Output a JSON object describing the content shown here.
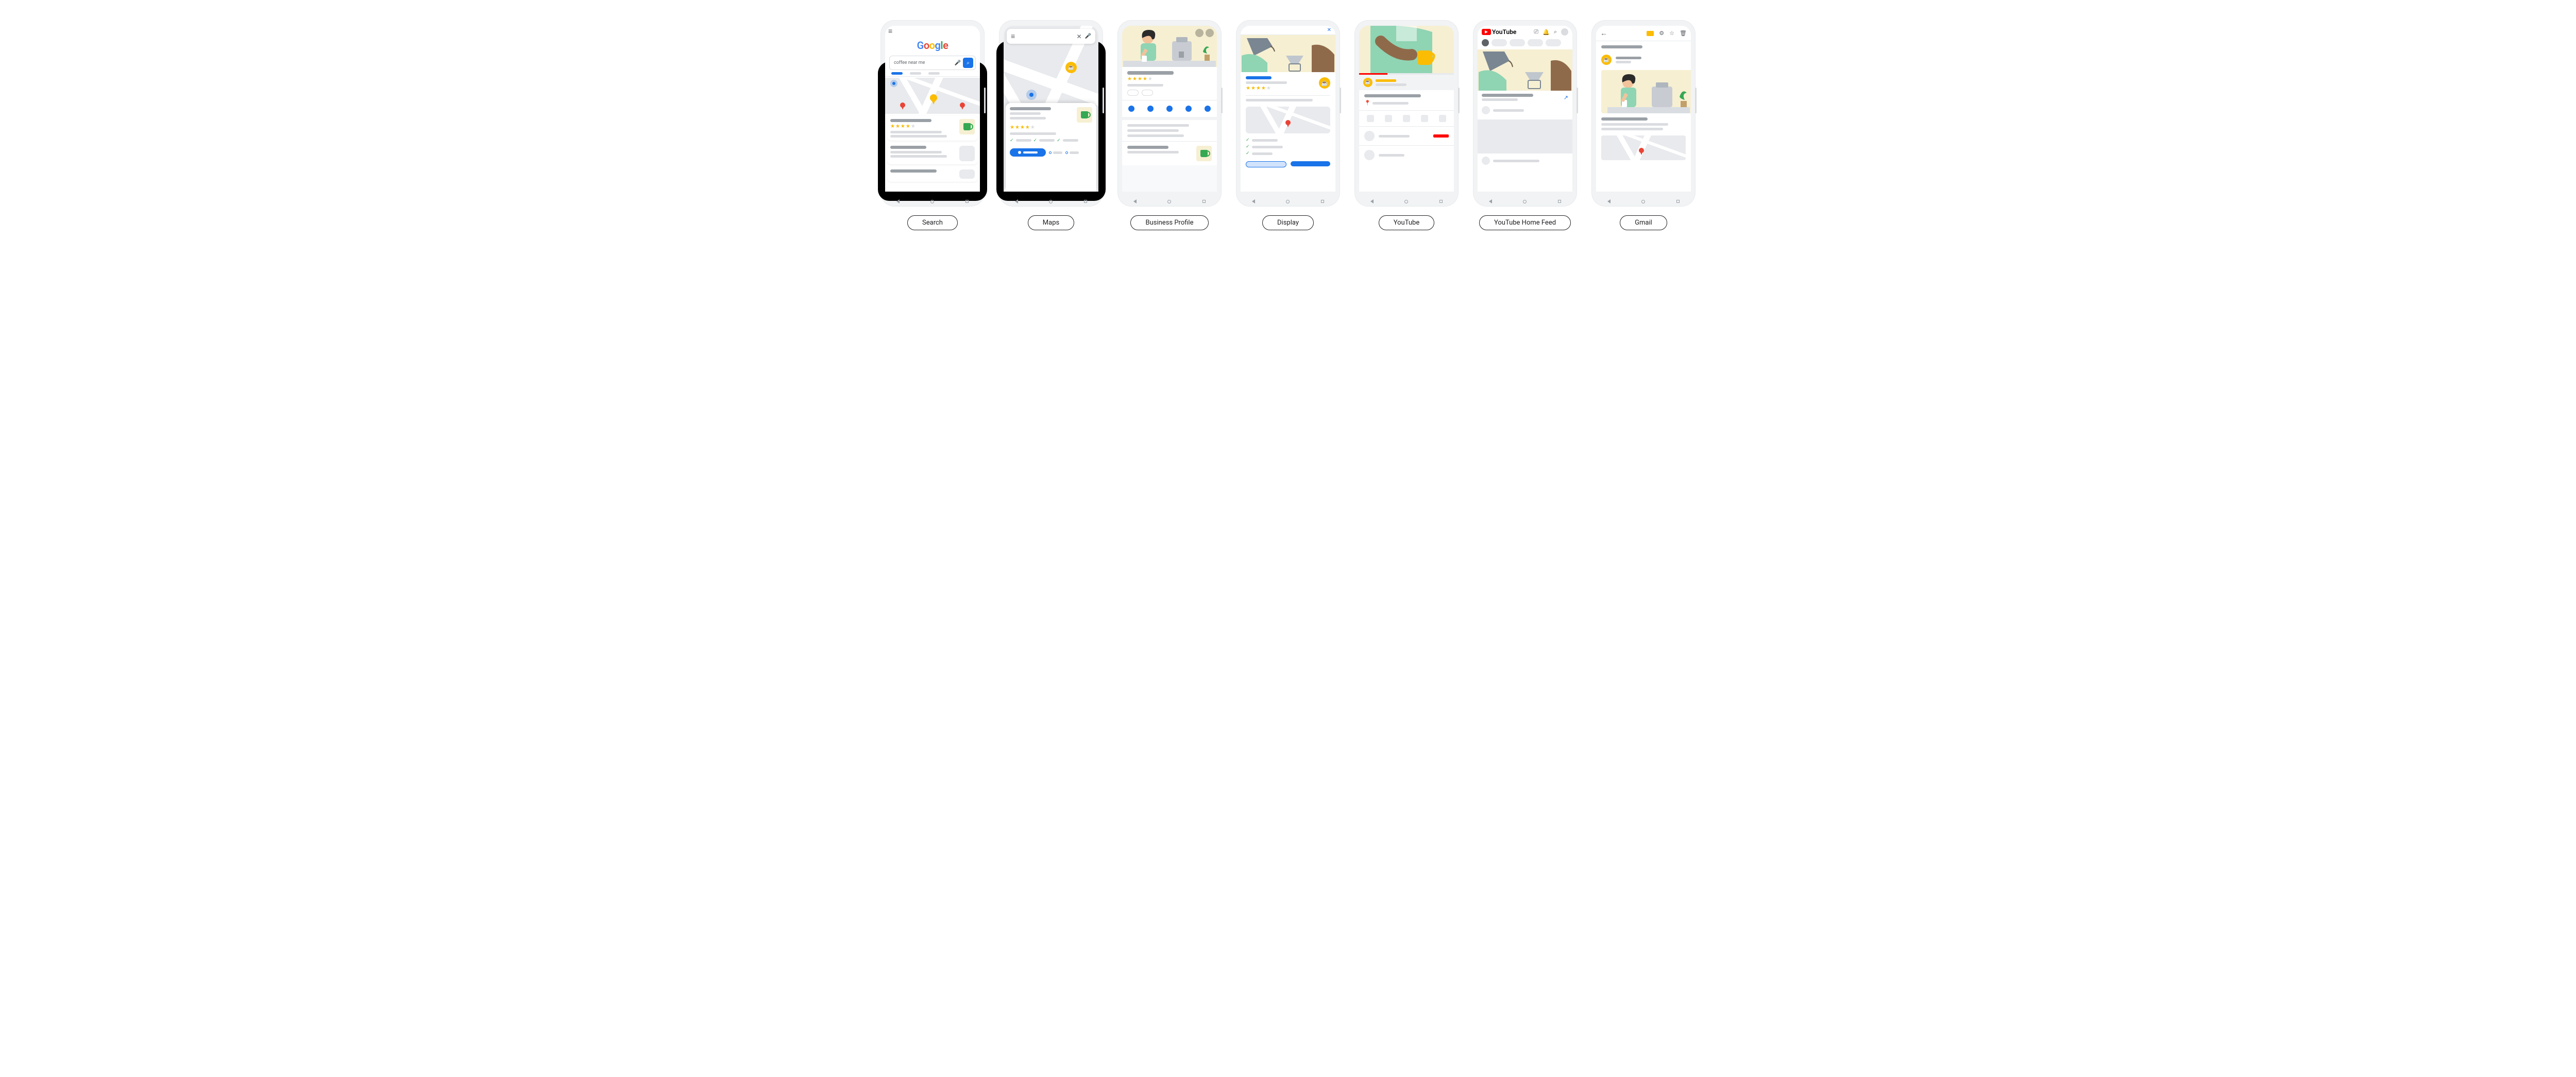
{
  "labels": {
    "search": "Search",
    "maps": "Maps",
    "business_profile": "Business Profile",
    "display": "Display",
    "youtube": "YouTube",
    "youtube_home_feed": "YouTube Home Feed",
    "gmail": "Gmail"
  },
  "search": {
    "query": "coffee near me"
  },
  "youtube": {
    "logo_text": "YouTube"
  },
  "colors": {
    "google_blue": "#1a73e8",
    "google_red": "#ea4335",
    "google_yellow": "#fbbc04",
    "google_green": "#34a853",
    "youtube_red": "#ff0000",
    "illustration_bg": "#f6efd2",
    "apron_green": "#8fd4b3"
  }
}
